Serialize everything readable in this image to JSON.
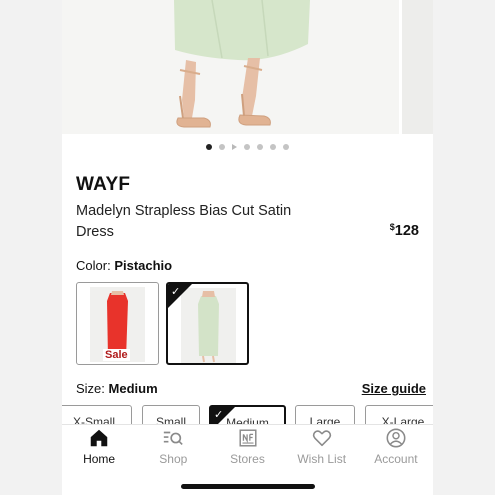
{
  "product": {
    "brand": "WAYF",
    "name": "Madelyn Strapless Bias Cut Satin Dress",
    "price_symbol": "$",
    "price_value": "128",
    "image_count": 6,
    "active_image_index": 0
  },
  "color": {
    "label": "Color:",
    "selected": "Pistachio",
    "swatches": [
      {
        "badge": "Sale",
        "selected": false,
        "dress_color": "#e8332b"
      },
      {
        "badge": "",
        "selected": true,
        "dress_color": "#d3e3c8"
      }
    ]
  },
  "size": {
    "label": "Size:",
    "selected": "Medium",
    "guide_label": "Size guide",
    "options": [
      {
        "label": "X-Small",
        "selected": false
      },
      {
        "label": "Small",
        "selected": false
      },
      {
        "label": "Medium",
        "selected": true
      },
      {
        "label": "Large",
        "selected": false
      },
      {
        "label": "X-Large",
        "selected": false
      }
    ]
  },
  "tabbar": {
    "items": [
      {
        "label": "Home",
        "icon": "home-icon",
        "active": true
      },
      {
        "label": "Shop",
        "icon": "shop-search-icon",
        "active": false
      },
      {
        "label": "Stores",
        "icon": "stores-icon",
        "active": false
      },
      {
        "label": "Wish List",
        "icon": "heart-icon",
        "active": false
      },
      {
        "label": "Account",
        "icon": "account-icon",
        "active": false
      }
    ]
  },
  "colors": {
    "dress_main": "#d6e6cb",
    "skin": "#e6bfa6",
    "text": "#111111",
    "inactive_tab": "#9a9a9a"
  }
}
